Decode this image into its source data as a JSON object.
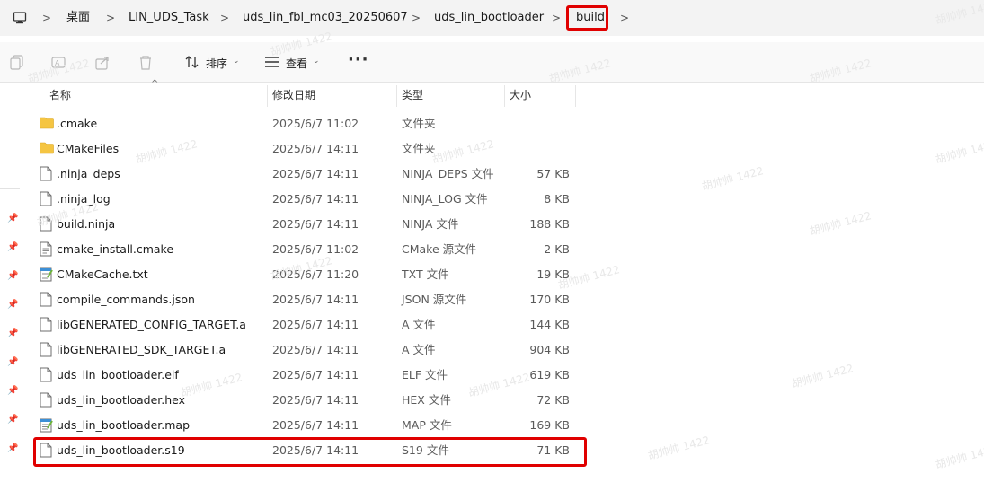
{
  "breadcrumb": {
    "items": [
      "桌面",
      "LIN_UDS_Task",
      "uds_lin_fbl_mc03_20250607",
      "uds_lin_bootloader",
      "build"
    ]
  },
  "toolbar": {
    "sort_label": "排序",
    "view_label": "查看",
    "more_label": "···"
  },
  "columns": {
    "name": "名称",
    "date": "修改日期",
    "type": "类型",
    "size": "大小"
  },
  "files": [
    {
      "name": ".cmake",
      "date": "2025/6/7 11:02",
      "type": "文件夹",
      "size": "",
      "icon": "folder-icon"
    },
    {
      "name": "CMakeFiles",
      "date": "2025/6/7 14:11",
      "type": "文件夹",
      "size": "",
      "icon": "folder-icon"
    },
    {
      "name": ".ninja_deps",
      "date": "2025/6/7 14:11",
      "type": "NINJA_DEPS 文件",
      "size": "57 KB",
      "icon": "file-icon"
    },
    {
      "name": ".ninja_log",
      "date": "2025/6/7 14:11",
      "type": "NINJA_LOG 文件",
      "size": "8 KB",
      "icon": "file-icon"
    },
    {
      "name": "build.ninja",
      "date": "2025/6/7 14:11",
      "type": "NINJA 文件",
      "size": "188 KB",
      "icon": "file-icon"
    },
    {
      "name": "cmake_install.cmake",
      "date": "2025/6/7 11:02",
      "type": "CMake 源文件",
      "size": "2 KB",
      "icon": "text-file-icon"
    },
    {
      "name": "CMakeCache.txt",
      "date": "2025/6/7 11:20",
      "type": "TXT 文件",
      "size": "19 KB",
      "icon": "notepad-file-icon"
    },
    {
      "name": "compile_commands.json",
      "date": "2025/6/7 14:11",
      "type": "JSON 源文件",
      "size": "170 KB",
      "icon": "file-icon"
    },
    {
      "name": "libGENERATED_CONFIG_TARGET.a",
      "date": "2025/6/7 14:11",
      "type": "A 文件",
      "size": "144 KB",
      "icon": "file-icon"
    },
    {
      "name": "libGENERATED_SDK_TARGET.a",
      "date": "2025/6/7 14:11",
      "type": "A 文件",
      "size": "904 KB",
      "icon": "file-icon"
    },
    {
      "name": "uds_lin_bootloader.elf",
      "date": "2025/6/7 14:11",
      "type": "ELF 文件",
      "size": "619 KB",
      "icon": "file-icon"
    },
    {
      "name": "uds_lin_bootloader.hex",
      "date": "2025/6/7 14:11",
      "type": "HEX 文件",
      "size": "72 KB",
      "icon": "file-icon"
    },
    {
      "name": "uds_lin_bootloader.map",
      "date": "2025/6/7 14:11",
      "type": "MAP 文件",
      "size": "169 KB",
      "icon": "notepad-file-icon"
    },
    {
      "name": "uds_lin_bootloader.s19",
      "date": "2025/6/7 14:11",
      "type": "S19 文件",
      "size": "71 KB",
      "icon": "file-icon"
    }
  ],
  "watermark": "胡帅帅 1422",
  "colors": {
    "highlight": "#e00000",
    "folder": "#f5c542"
  }
}
